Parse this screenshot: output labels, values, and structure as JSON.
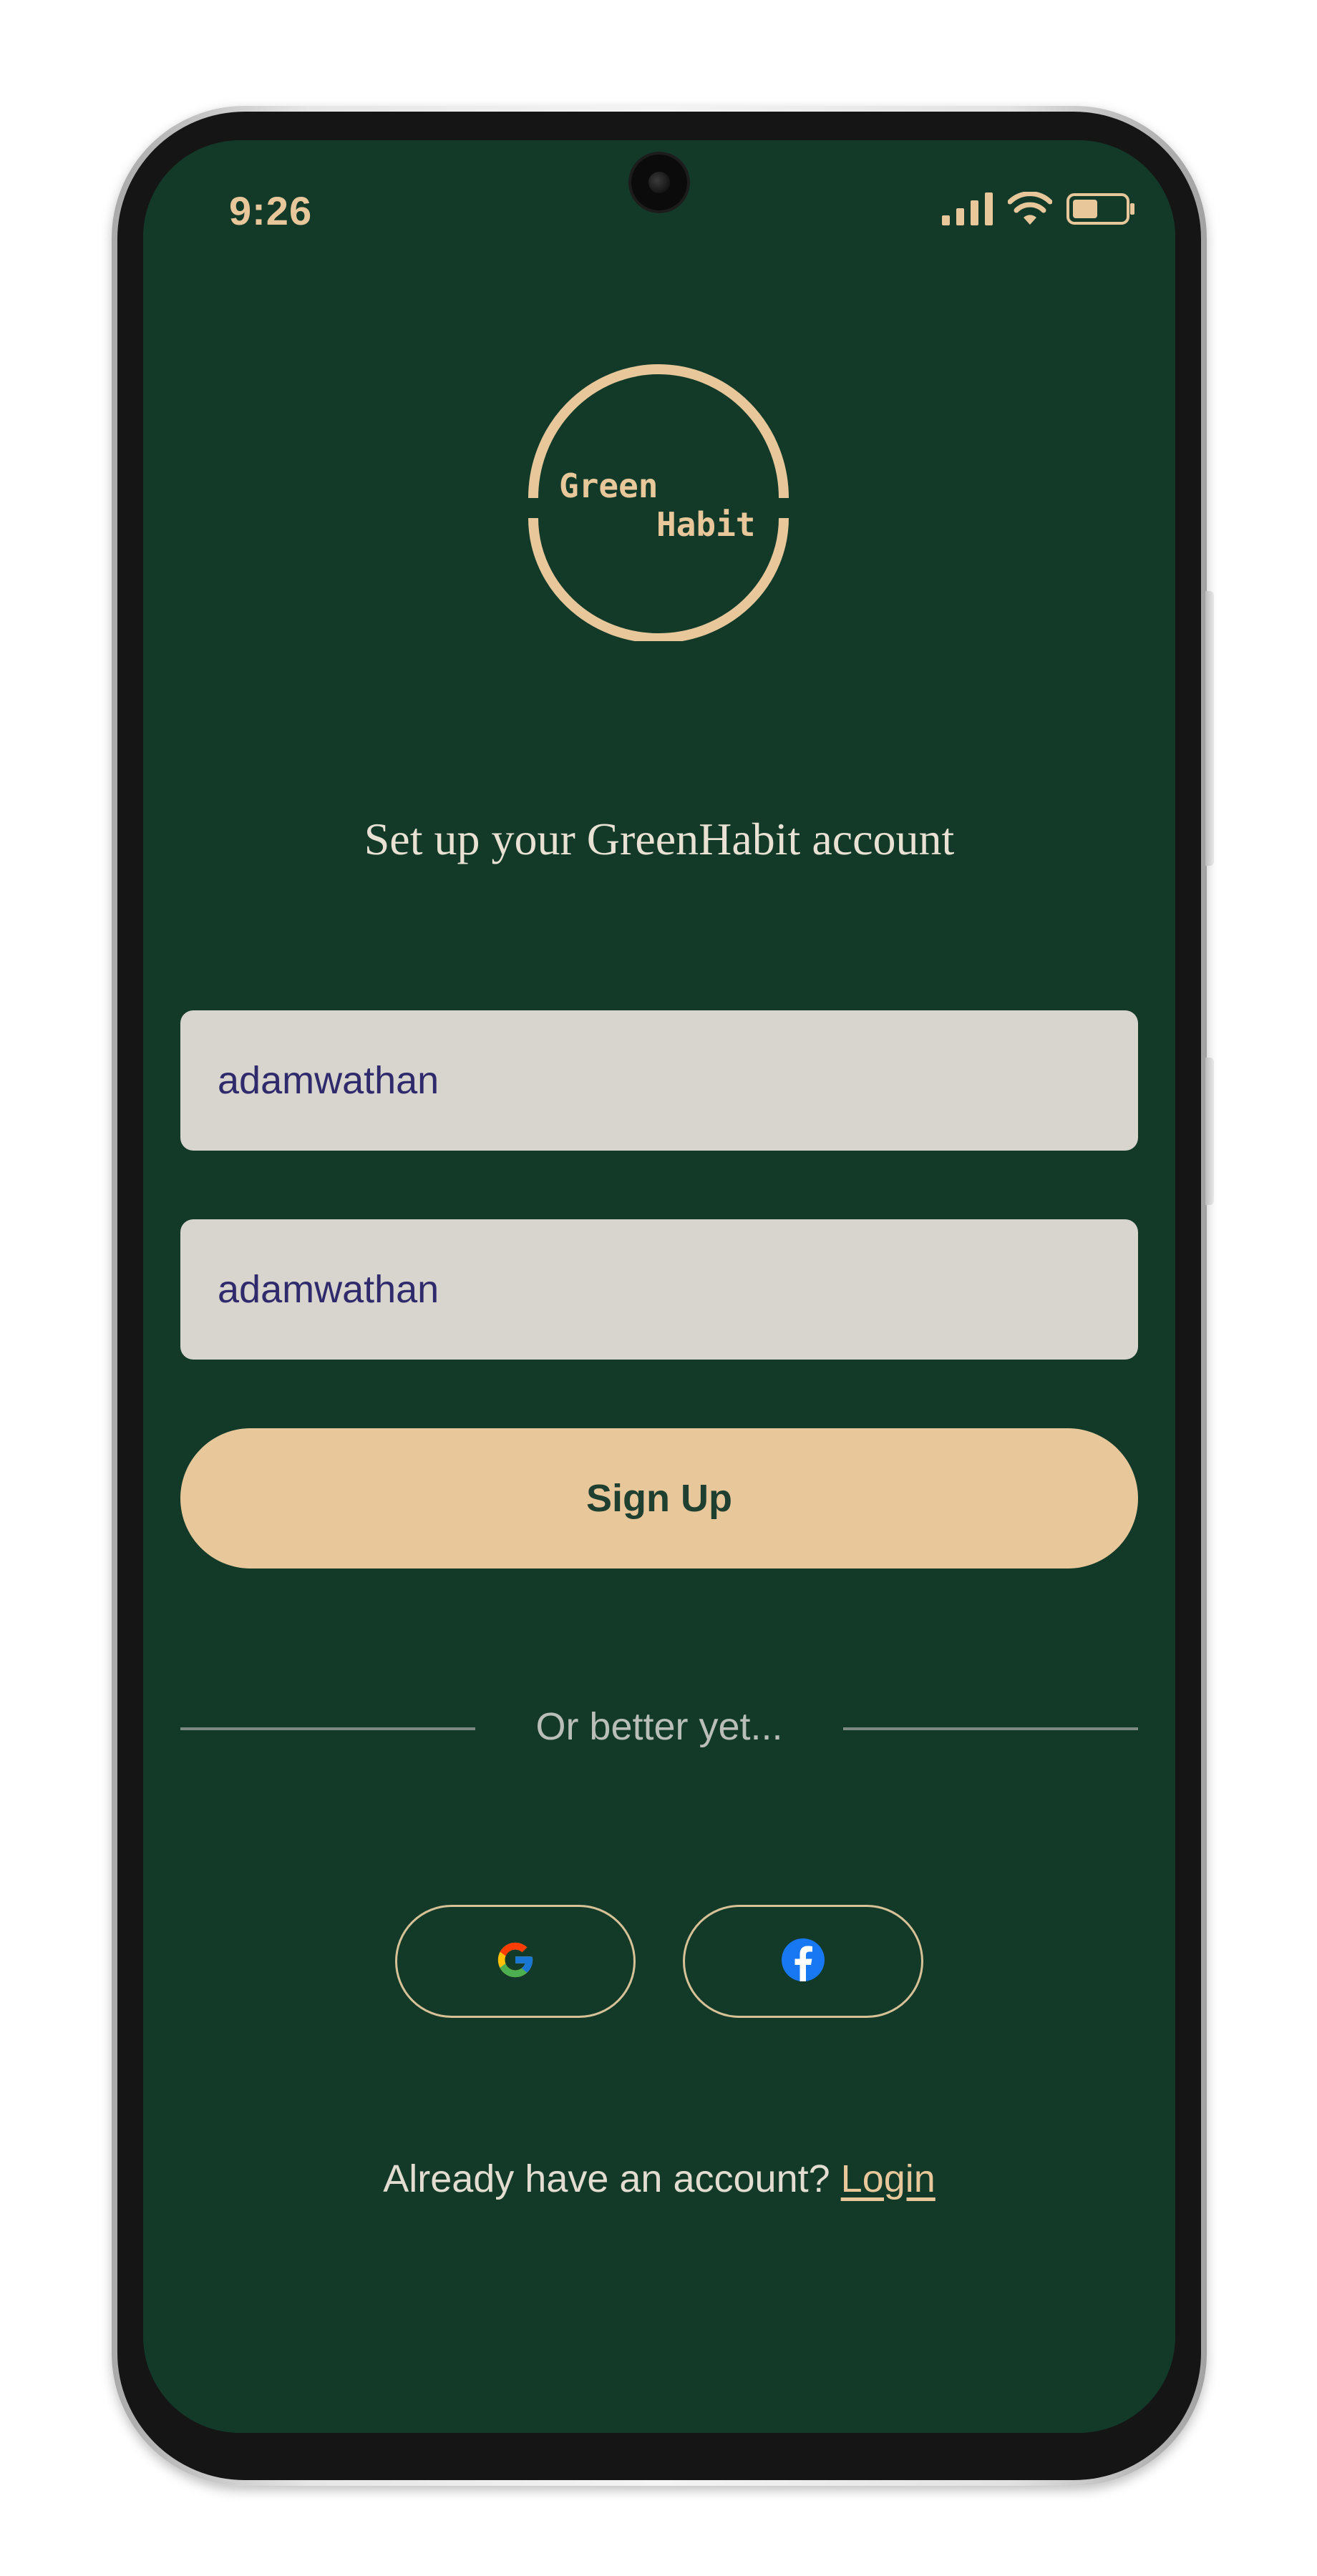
{
  "status_bar": {
    "time": "9:26",
    "icons": [
      "signal-icon",
      "wifi-icon",
      "battery-icon"
    ]
  },
  "logo": {
    "word1": "Green",
    "word2": "Habit"
  },
  "heading": "Set up your GreenHabit account",
  "form": {
    "field1_value": "adamwathan",
    "field2_value": "adamwathan",
    "signup_label": "Sign Up"
  },
  "divider_text": "Or better yet...",
  "social": {
    "google_icon": "google-icon",
    "facebook_icon": "facebook-icon"
  },
  "footer": {
    "prompt": "Already have an account?",
    "login_label": "Login"
  },
  "colors": {
    "background": "#133a29",
    "accent": "#e8c89b",
    "input_bg": "#d8d4ce",
    "input_text": "#2f2a6b"
  }
}
